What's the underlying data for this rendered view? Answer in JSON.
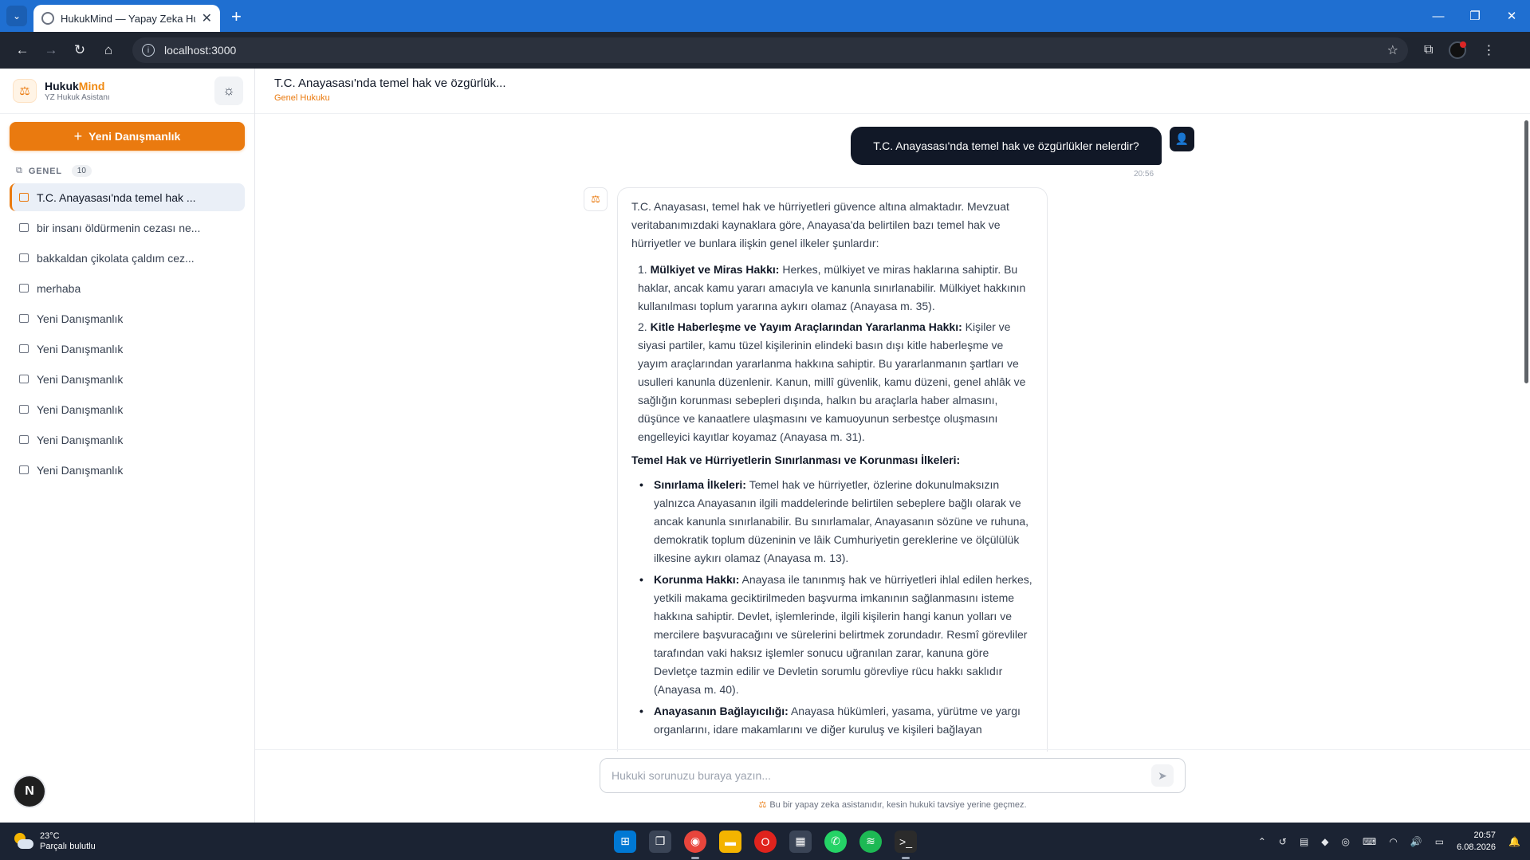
{
  "browser": {
    "tab_title": "HukukMind — Yapay Zeka Hukuk Asistanı",
    "url": "localhost:3000",
    "tab_close": "✕",
    "new_tab": "+",
    "menu_glyph": "⌄",
    "win_minimize": "—",
    "win_restore": "❐",
    "win_close": "✕"
  },
  "sidebar": {
    "brand_left": "Hukuk",
    "brand_right": "Mind",
    "brand_sub": "YZ Hukuk Asistanı",
    "theme_icon": "sun-icon",
    "new_consult_label": "Yeni Danışmanlık",
    "group_label": "GENEL",
    "group_count": "10",
    "conversations": [
      {
        "label": "T.C. Anayasası'nda temel hak ...",
        "active": true
      },
      {
        "label": "bir insanı öldürmenin cezası ne...",
        "active": false
      },
      {
        "label": "bakkaldan çikolata çaldım cez...",
        "active": false
      },
      {
        "label": "merhaba",
        "active": false
      },
      {
        "label": "Yeni Danışmanlık",
        "active": false
      },
      {
        "label": "Yeni Danışmanlık",
        "active": false
      },
      {
        "label": "Yeni Danışmanlık",
        "active": false
      },
      {
        "label": "Yeni Danışmanlık",
        "active": false
      },
      {
        "label": "Yeni Danışmanlık",
        "active": false
      },
      {
        "label": "Yeni Danışmanlık",
        "active": false
      }
    ],
    "n_badge": "N"
  },
  "main": {
    "title": "T.C. Anayasası'nda temel hak ve özgürlük...",
    "category": "Genel Hukuku"
  },
  "chat": {
    "user_message": "T.C. Anayasası'nda temel hak ve özgürlükler nelerdir?",
    "user_time": "20:56",
    "bot": {
      "intro": "T.C. Anayasası, temel hak ve hürriyetleri güvence altına almaktadır. Mevzuat veritabanımızdaki kaynaklara göre, Anayasa'da belirtilen bazı temel hak ve hürriyetler ve bunlara ilişkin genel ilkeler şunlardır:",
      "numbered": [
        {
          "num": "1.",
          "title": "Mülkiyet ve Miras Hakkı:",
          "text": " Herkes, mülkiyet ve miras haklarına sahiptir. Bu haklar, ancak kamu yararı amacıyla ve kanunla sınırlanabilir. Mülkiyet hakkının kullanılması toplum yararına aykırı olamaz (Anayasa m. 35)."
        },
        {
          "num": "2.",
          "title": "Kitle Haberleşme ve Yayım Araçlarından Yararlanma Hakkı:",
          "text": " Kişiler ve siyasi partiler, kamu tüzel kişilerinin elindeki basın dışı kitle haberleşme ve yayım araçlarından yararlanma hakkına sahiptir. Bu yararlanmanın şartları ve usulleri kanunla düzenlenir. Kanun, millî güvenlik, kamu düzeni, genel ahlâk ve sağlığın korunması sebepleri dışında, halkın bu araçlarla haber almasını, düşünce ve kanaatlere ulaşmasını ve kamuoyunun serbestçe oluşmasını engelleyici kayıtlar koyamaz (Anayasa m. 31)."
        }
      ],
      "heading": "Temel Hak ve Hürriyetlerin Sınırlanması ve Korunması İlkeleri:",
      "bullets": [
        {
          "title": "Sınırlama İlkeleri:",
          "text": " Temel hak ve hürriyetler, özlerine dokunulmaksızın yalnızca Anayasanın ilgili maddelerinde belirtilen sebeplere bağlı olarak ve ancak kanunla sınırlanabilir. Bu sınırlamalar, Anayasanın sözüne ve ruhuna, demokratik toplum düzeninin ve lâik Cumhuriyetin gereklerine ve ölçülülük ilkesine aykırı olamaz (Anayasa m. 13)."
        },
        {
          "title": "Korunma Hakkı:",
          "text": " Anayasa ile tanınmış hak ve hürriyetleri ihlal edilen herkes, yetkili makama geciktirilmeden başvurma imkanının sağlanmasını isteme hakkına sahiptir. Devlet, işlemlerinde, ilgili kişilerin hangi kanun yolları ve mercilere başvuracağını ve sürelerini belirtmek zorundadır. Resmî görevliler tarafından vaki haksız işlemler sonucu uğranılan zarar, kanuna göre Devletçe tazmin edilir ve Devletin sorumlu görevliye rücu hakkı saklıdır (Anayasa m. 40)."
        },
        {
          "title": "Anayasanın Bağlayıcılığı:",
          "text": " Anayasa hükümleri, yasama, yürütme ve yargı organlarını, idare makamlarını ve diğer kuruluş ve kişileri bağlayan"
        }
      ]
    }
  },
  "composer": {
    "placeholder": "Hukuki sorunuzu buraya yazın...",
    "disclaimer": "Bu bir yapay zeka asistanıdır, kesin hukuki tavsiye yerine geçmez."
  },
  "taskbar": {
    "temperature": "23°C",
    "weather": "Parçalı bulutlu",
    "time": "20:57",
    "date": "6.08.2026"
  }
}
